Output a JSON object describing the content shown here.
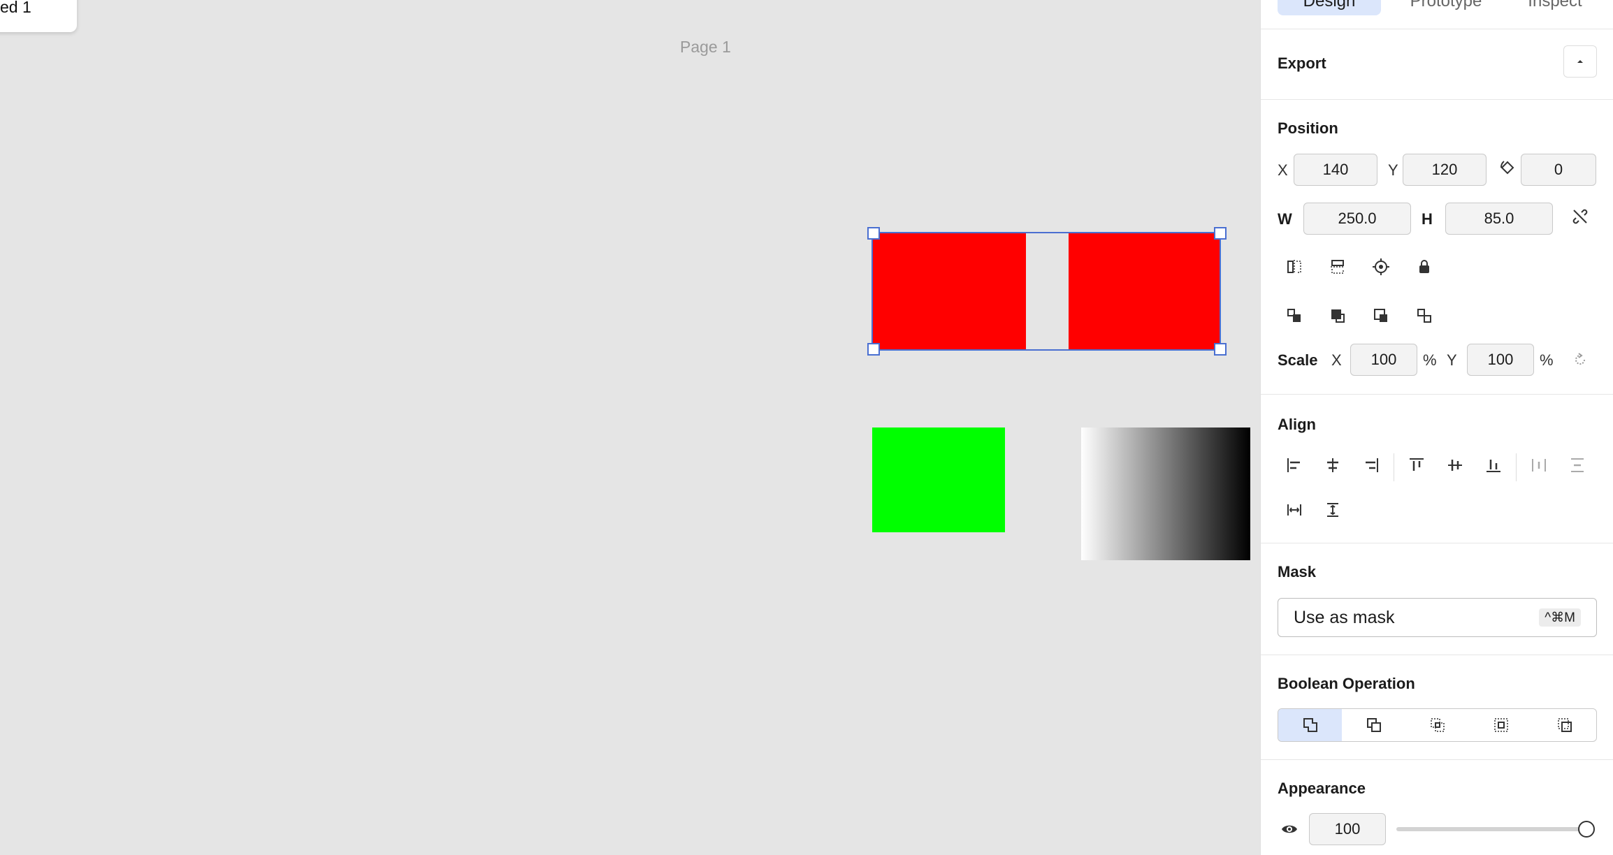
{
  "canvas": {
    "tooltip_text": "ed 1",
    "page_label": "Page 1",
    "colors": {
      "red": "#ff0000",
      "green": "#00ff00",
      "gradient_from": "#ffffff",
      "gradient_to": "#000000",
      "selection": "#4a6fd1"
    }
  },
  "tabs": {
    "design": "Design",
    "prototype": "Prototype",
    "inspect": "Inspect"
  },
  "export": {
    "title": "Export"
  },
  "position": {
    "title": "Position",
    "x_label": "X",
    "x": "140",
    "y_label": "Y",
    "y": "120",
    "rotation": "0",
    "w_label": "W",
    "w": "250.0",
    "h_label": "H",
    "h": "85.0",
    "scale_label": "Scale",
    "scale_x_label": "X",
    "scale_x": "100",
    "scale_y_label": "Y",
    "scale_y": "100",
    "percent": "%"
  },
  "align": {
    "title": "Align"
  },
  "mask": {
    "title": "Mask",
    "button_label": "Use as mask",
    "shortcut": "^⌘M"
  },
  "boolean": {
    "title": "Boolean Operation"
  },
  "appearance": {
    "title": "Appearance",
    "opacity": "100",
    "opacity_level": 1.0
  }
}
